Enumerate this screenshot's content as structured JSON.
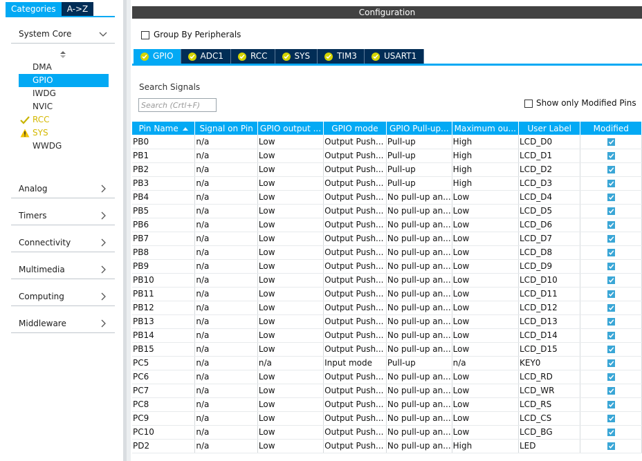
{
  "left": {
    "tabs": [
      "Categories",
      "A->Z"
    ],
    "categories": [
      {
        "label": "System Core",
        "expanded": true
      },
      {
        "label": "Analog"
      },
      {
        "label": "Timers"
      },
      {
        "label": "Connectivity"
      },
      {
        "label": "Multimedia"
      },
      {
        "label": "Computing"
      },
      {
        "label": "Middleware"
      }
    ],
    "system_core_items": [
      {
        "label": "DMA",
        "state": "none"
      },
      {
        "label": "GPIO",
        "state": "selected"
      },
      {
        "label": "IWDG",
        "state": "none"
      },
      {
        "label": "NVIC",
        "state": "none"
      },
      {
        "label": "RCC",
        "state": "ok"
      },
      {
        "label": "SYS",
        "state": "warning"
      },
      {
        "label": "WWDG",
        "state": "none"
      }
    ]
  },
  "config": {
    "header": "Configuration",
    "group_by": "Group By Peripherals",
    "tabs": [
      "GPIO",
      "ADC1",
      "RCC",
      "SYS",
      "TIM3",
      "USART1"
    ],
    "search_label": "Search Signals",
    "search_placeholder": "Search (Crtl+F)",
    "show_modified": "Show only Modified Pins"
  },
  "table": {
    "columns": [
      "Pin Name",
      "Signal on Pin",
      "GPIO output ...",
      "GPIO mode",
      "GPIO Pull-up...",
      "Maximum ou...",
      "User Label",
      "Modified"
    ],
    "rows": [
      [
        "PB0",
        "n/a",
        "Low",
        "Output Push...",
        "Pull-up",
        "High",
        "LCD_D0"
      ],
      [
        "PB1",
        "n/a",
        "Low",
        "Output Push...",
        "Pull-up",
        "High",
        "LCD_D1"
      ],
      [
        "PB2",
        "n/a",
        "Low",
        "Output Push...",
        "Pull-up",
        "High",
        "LCD_D2"
      ],
      [
        "PB3",
        "n/a",
        "Low",
        "Output Push...",
        "Pull-up",
        "High",
        "LCD_D3"
      ],
      [
        "PB4",
        "n/a",
        "Low",
        "Output Push...",
        "No pull-up an...",
        "Low",
        "LCD_D4"
      ],
      [
        "PB5",
        "n/a",
        "Low",
        "Output Push...",
        "No pull-up an...",
        "Low",
        "LCD_D5"
      ],
      [
        "PB6",
        "n/a",
        "Low",
        "Output Push...",
        "No pull-up an...",
        "Low",
        "LCD_D6"
      ],
      [
        "PB7",
        "n/a",
        "Low",
        "Output Push...",
        "No pull-up an...",
        "Low",
        "LCD_D7"
      ],
      [
        "PB8",
        "n/a",
        "Low",
        "Output Push...",
        "No pull-up an...",
        "Low",
        "LCD_D8"
      ],
      [
        "PB9",
        "n/a",
        "Low",
        "Output Push...",
        "No pull-up an...",
        "Low",
        "LCD_D9"
      ],
      [
        "PB10",
        "n/a",
        "Low",
        "Output Push...",
        "No pull-up an...",
        "Low",
        "LCD_D10"
      ],
      [
        "PB11",
        "n/a",
        "Low",
        "Output Push...",
        "No pull-up an...",
        "Low",
        "LCD_D11"
      ],
      [
        "PB12",
        "n/a",
        "Low",
        "Output Push...",
        "No pull-up an...",
        "Low",
        "LCD_D12"
      ],
      [
        "PB13",
        "n/a",
        "Low",
        "Output Push...",
        "No pull-up an...",
        "Low",
        "LCD_D13"
      ],
      [
        "PB14",
        "n/a",
        "Low",
        "Output Push...",
        "No pull-up an...",
        "Low",
        "LCD_D14"
      ],
      [
        "PB15",
        "n/a",
        "Low",
        "Output Push...",
        "No pull-up an...",
        "Low",
        "LCD_D15"
      ],
      [
        "PC5",
        "n/a",
        "n/a",
        "Input mode",
        "Pull-up",
        "n/a",
        "KEY0"
      ],
      [
        "PC6",
        "n/a",
        "Low",
        "Output Push...",
        "No pull-up an...",
        "Low",
        "LCD_RD"
      ],
      [
        "PC7",
        "n/a",
        "Low",
        "Output Push...",
        "No pull-up an...",
        "Low",
        "LCD_WR"
      ],
      [
        "PC8",
        "n/a",
        "Low",
        "Output Push...",
        "No pull-up an...",
        "Low",
        "LCD_RS"
      ],
      [
        "PC9",
        "n/a",
        "Low",
        "Output Push...",
        "No pull-up an...",
        "Low",
        "LCD_CS"
      ],
      [
        "PC10",
        "n/a",
        "Low",
        "Output Push...",
        "No pull-up an...",
        "Low",
        "LCD_BG"
      ],
      [
        "PD2",
        "n/a",
        "Low",
        "Output Push...",
        "No pull-up an...",
        "High",
        "LED"
      ]
    ]
  }
}
